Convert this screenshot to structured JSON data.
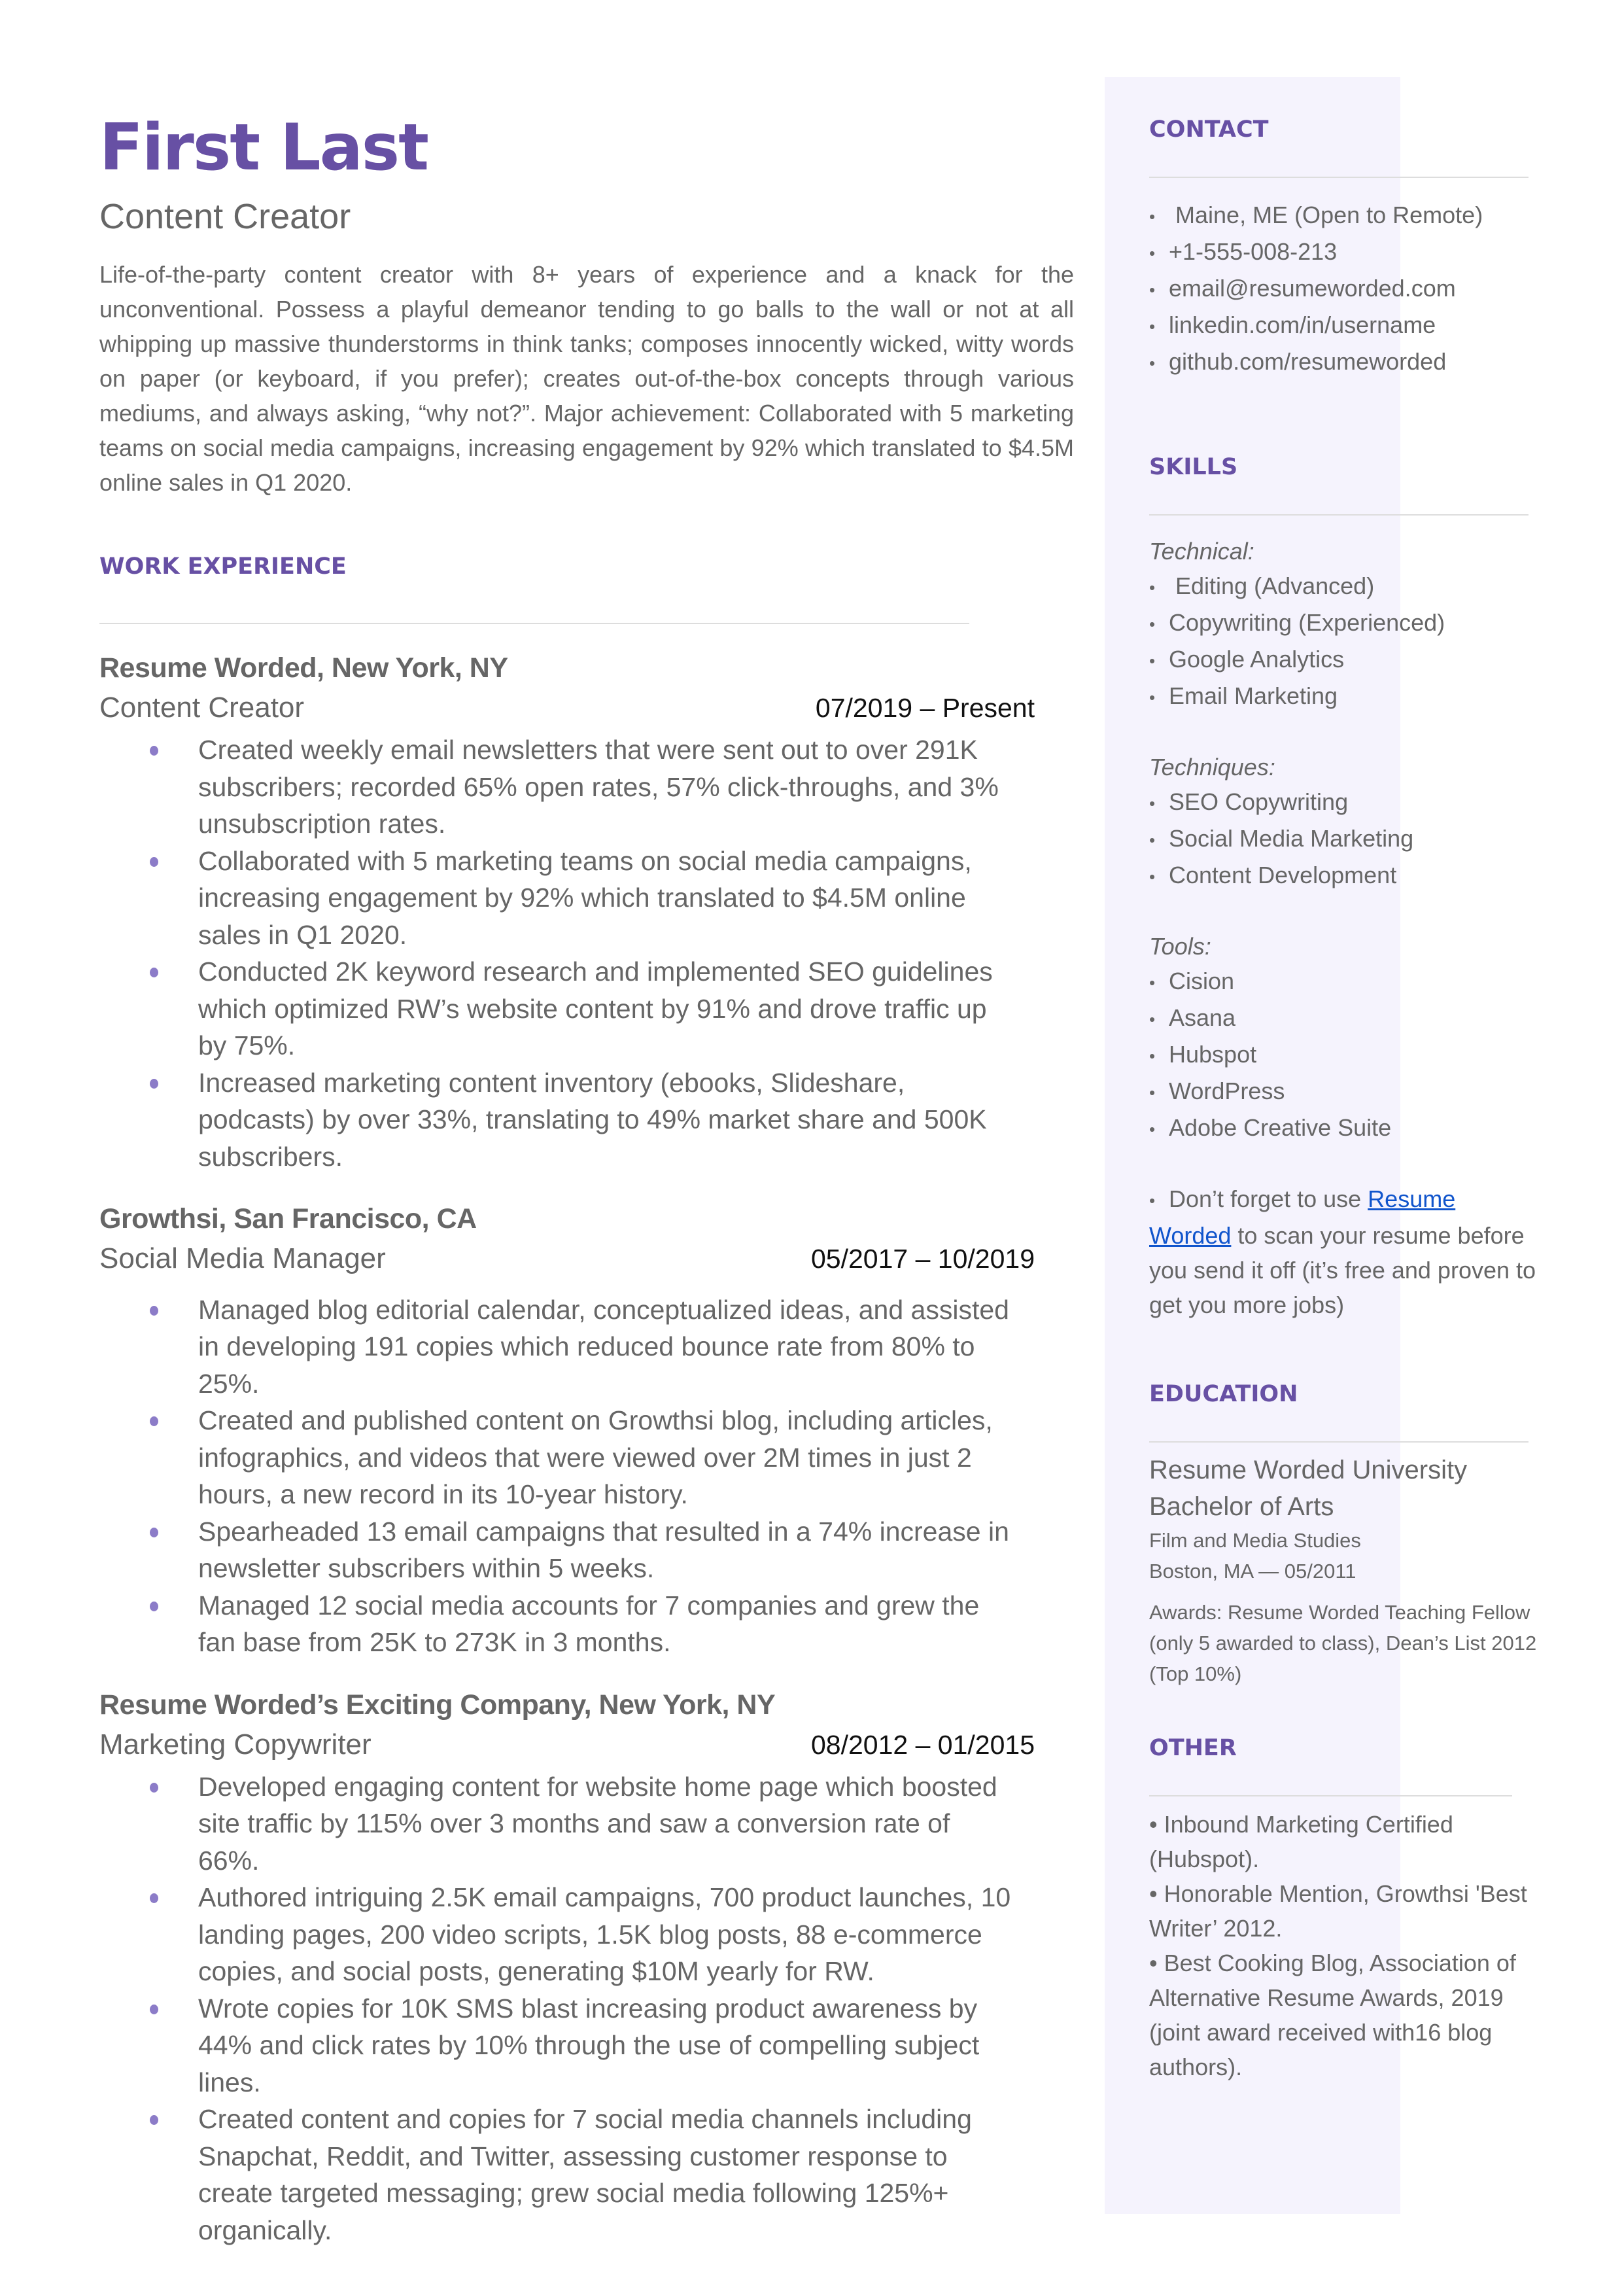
{
  "header": {
    "name": "First Last",
    "role": "Content Creator",
    "summary": "Life-of-the-party content creator with 8+ years of experience and a knack for the unconventional. Possess a playful demeanor tending to go balls to the wall or not at all whipping up massive thunderstorms in think tanks; composes innocently wicked, witty words on paper (or keyboard, if you prefer); creates out-of-the-box concepts through various mediums, and always asking, “why not?”. Major achievement: Collaborated with 5 marketing teams on social media campaigns, increasing engagement by 92% which translated to $4.5M online sales in Q1 2020."
  },
  "experience": {
    "heading": "WORK EXPERIENCE",
    "jobs": [
      {
        "company": "Resume Worded, New York, NY",
        "title": "Content Creator",
        "dates": "07/2019 – Present",
        "bullets": [
          "Created weekly email newsletters that were sent out to over 291K subscribers; recorded 65% open rates, 57% click-throughs, and 3% unsubscription rates.",
          "Collaborated with 5 marketing teams on social media campaigns, increasing engagement by 92% which translated to $4.5M online sales in Q1 2020.",
          "Conducted 2K keyword research and implemented SEO guidelines which optimized RW’s website content by 91% and drove traffic up by 75%.",
          "Increased marketing content inventory (ebooks, Slideshare, podcasts) by over 33%, translating to 49% market share and 500K subscribers."
        ]
      },
      {
        "company": "Growthsi, San Francisco, CA",
        "title": "Social Media Manager",
        "dates": "05/2017 – 10/2019",
        "bullets": [
          "Managed blog editorial calendar, conceptualized ideas, and assisted in developing 191 copies which reduced bounce rate from 80% to 25%.",
          "Created and published content on Growthsi blog, including articles, infographics, and videos that were viewed over 2M times in just 2 hours, a new record in its 10-year history.",
          "Spearheaded 13 email campaigns that resulted in a 74% increase in newsletter subscribers within 5 weeks.",
          "Managed 12 social media accounts for 7 companies and grew the fan base from 25K to 273K in 3 months."
        ]
      },
      {
        "company": "Resume Worded’s Exciting Company, New York, NY",
        "title": "Marketing Copywriter",
        "dates": "08/2012 – 01/2015",
        "bullets": [
          "Developed engaging content for website home page which boosted site traffic by 115% over 3 months and saw a conversion rate of 66%.",
          "Authored intriguing 2.5K email campaigns, 700 product launches, 10 landing pages, 200 video scripts, 1.5K blog posts, 88 e-commerce copies, and social posts, generating $10M yearly for RW.",
          "Wrote copies for 10K SMS blast increasing product awareness by 44% and click rates by 10% through the use of compelling subject lines.",
          "Created content and copies for 7 social media channels including Snapchat, Reddit, and Twitter, assessing customer response to create targeted messaging; grew social media following 125%+ organically."
        ]
      }
    ]
  },
  "sidebar": {
    "contact": {
      "heading": "CONTACT",
      "items": [
        "Maine, ME (Open to Remote)",
        "+1-555-008-213",
        "email@resumeworded.com",
        "linkedin.com/in/username",
        "github.com/resumeworded"
      ]
    },
    "skills": {
      "heading": "SKILLS",
      "technical_label": "Technical:",
      "technical": [
        "Editing (Advanced)",
        "Copywriting (Experienced)",
        "Google Analytics",
        "Email Marketing"
      ],
      "techniques_label": "Techniques:",
      "techniques": [
        "SEO Copywriting",
        "Social Media Marketing",
        "Content Development"
      ],
      "tools_label": "Tools:",
      "tools": [
        "Cision",
        "Asana",
        "Hubspot",
        "WordPress",
        "Adobe Creative Suite"
      ],
      "tip_prefix": "Don’t forget to use ",
      "tip_link": "Resume Worded",
      "tip_suffix": " to scan your resume before you send it off (it’s free and proven to get you more jobs)"
    },
    "education": {
      "heading": "EDUCATION",
      "school": "Resume Worded University",
      "degree": "Bachelor of Arts",
      "field": "Film and Media Studies",
      "location_date": "Boston, MA — 05/2011",
      "awards": "Awards: Resume Worded Teaching Fellow (only 5 awarded to class), Dean’s List 2012 (Top 10%)"
    },
    "other": {
      "heading": "OTHER",
      "items": [
        "• Inbound Marketing Certified (Hubspot).",
        "• Honorable Mention, Growthsi 'Best Writer’ 2012.",
        "• Best Cooking Blog, Association of Alternative Resume Awards, 2019 (joint award received with16 blog authors)."
      ]
    }
  },
  "colors": {
    "accent": "#6750A4",
    "bullet": "#8C7CC8",
    "sidebar_bg": "#F5F3FD",
    "body_text": "#666666",
    "link": "#1155CC"
  }
}
